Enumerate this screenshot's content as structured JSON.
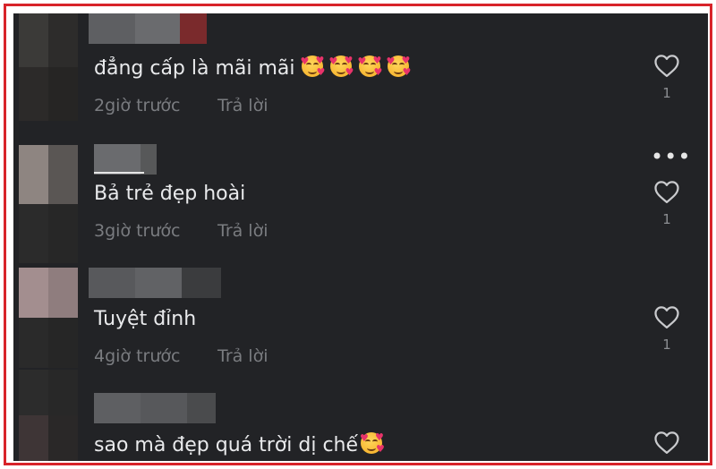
{
  "colors": {
    "background": "#222326",
    "border": "#d8232a",
    "text": "#e9eaec",
    "meta": "#7a7c80"
  },
  "comments": [
    {
      "text": "đẳng cấp là mãi mãi",
      "emoji_count": 4,
      "time": "2giờ trước",
      "reply": "Trả lời",
      "likes": "1",
      "icon": "heart-outline-icon"
    },
    {
      "text": "Bả trẻ đẹp hoài",
      "emoji_count": 0,
      "time": "3giờ trước",
      "reply": "Trả lời",
      "likes": "1",
      "icon": "heart-outline-icon"
    },
    {
      "text": "Tuyệt đỉnh",
      "emoji_count": 0,
      "time": "4giờ trước",
      "reply": "Trả lời",
      "likes": "1",
      "icon": "heart-outline-icon"
    },
    {
      "text": "sao mà đẹp quá trời dị chế",
      "emoji_count": 1,
      "likes": "",
      "icon": "heart-outline-icon"
    }
  ],
  "more_icon": "more-horizontal-icon",
  "emoji_name": "smiling-face-with-hearts-emoji"
}
